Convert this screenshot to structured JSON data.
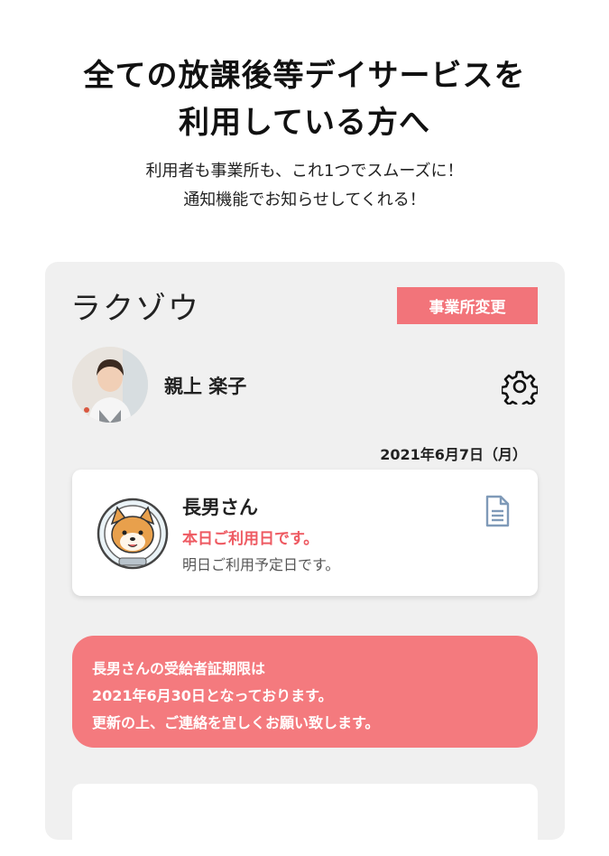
{
  "promo": {
    "headline_line1": "全ての放課後等デイサービスを",
    "headline_line2": "利用している方へ",
    "sub_line1": "利用者も事業所も、これ1つでスムーズに！",
    "sub_line2": "通知機能でお知らせしてくれる！"
  },
  "app": {
    "logo": "ラクゾウ",
    "office_change_label": "事業所変更",
    "user_name": "親上 楽子",
    "date": "2021年6月7日（月）",
    "child": {
      "name": "長男さん",
      "status_today": "本日ご利用日です。",
      "status_tomorrow": "明日ご利用予定日です。"
    },
    "notice": {
      "line1": "長男さんの受給者証期限は",
      "line2": "2021年6月30日となっております。",
      "line3": "更新の上、ご連絡を宜しくお願い致します。"
    }
  },
  "colors": {
    "accent": "#f2747a",
    "notice_bg": "#f47a7e",
    "status_red": "#ee5a62",
    "panel_bg": "#f0f0f0"
  },
  "icons": [
    "settings-gear-icon",
    "document-icon"
  ]
}
